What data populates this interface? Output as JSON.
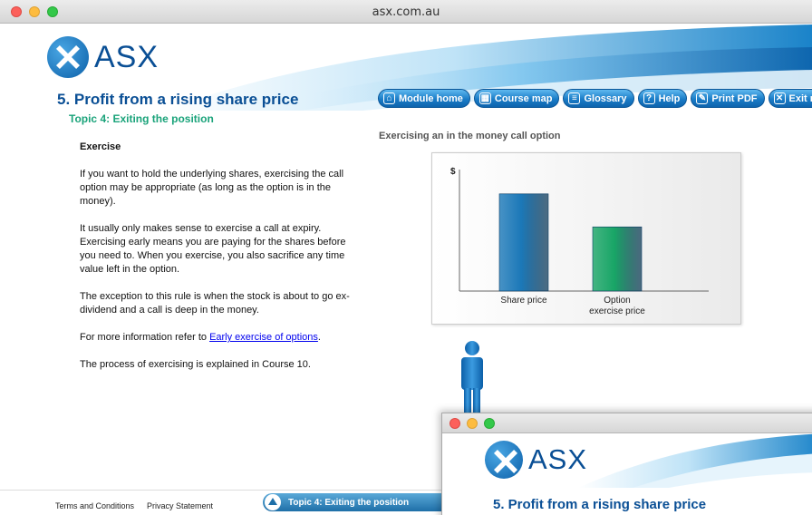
{
  "window": {
    "title": "asx.com.au"
  },
  "brand": {
    "logo_text": "ASX",
    "primary_color": "#0a4f95",
    "accent_green": "#1aa37a"
  },
  "header": {
    "page_title": "5. Profit from a rising share price",
    "topic": "Topic 4: Exiting the position"
  },
  "nav": [
    {
      "label": "Module home",
      "icon": "home-icon"
    },
    {
      "label": "Course map",
      "icon": "map-icon"
    },
    {
      "label": "Glossary",
      "icon": "list-icon"
    },
    {
      "label": "Help",
      "icon": "question-icon"
    },
    {
      "label": "Print PDF",
      "icon": "pdf-icon"
    },
    {
      "label": "Exit module",
      "icon": "close-icon"
    }
  ],
  "content": {
    "heading": "Exercise",
    "p1": "If you want to hold the underlying shares, exercising the call option may be appropriate (as long as the option is in the money).",
    "p2": "It usually only makes sense to exercise a call at expiry. Exercising early means you are paying for the shares before you need to. When you exercise, you also sacrifice any time value left in the option.",
    "p3": "The exception to this rule is when the stock is about to go ex-dividend and a call is deep in the money.",
    "p4_prefix": "For more information refer to ",
    "p4_link": "Early exercise of options",
    "p4_suffix": ".",
    "p5": "The process of exercising is explained in Course 10."
  },
  "chart_caption": "Exercising an in the money call option",
  "chart_data": {
    "type": "bar",
    "ylabel": "$",
    "categories": [
      "Share price",
      "Option exercise price"
    ],
    "category_lines": [
      [
        "Share price"
      ],
      [
        "Option",
        "exercise price"
      ]
    ],
    "values": [
      100,
      66
    ],
    "ylim": [
      0,
      125
    ],
    "colors": [
      "#1b78b8",
      "#18a566"
    ],
    "grid": false
  },
  "footer": {
    "terms": "Terms and Conditions",
    "privacy": "Privacy Statement",
    "topic_tab": "Topic 4: Exiting the position"
  },
  "second_window": {
    "logo_text": "ASX",
    "page_title": "5. Profit from a rising share price"
  }
}
